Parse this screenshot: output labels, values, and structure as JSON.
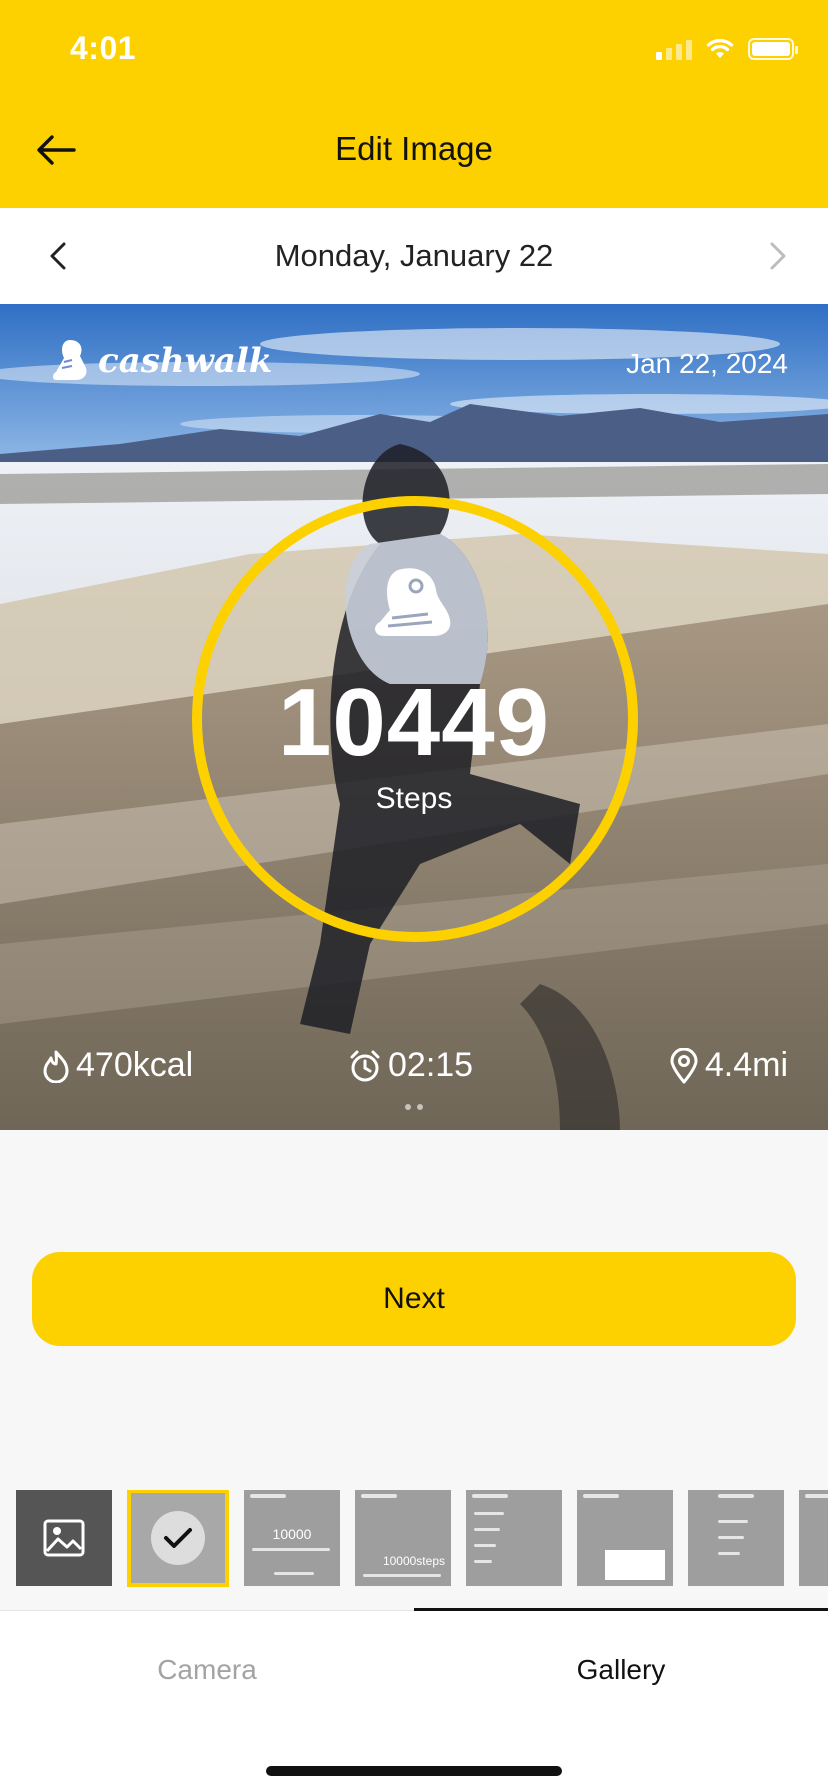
{
  "status_bar": {
    "time": "4:01",
    "icons": [
      "signal-icon",
      "wifi-icon",
      "battery-icon"
    ]
  },
  "header": {
    "title": "Edit Image",
    "back_icon": "arrow-left-icon"
  },
  "date_nav": {
    "label": "Monday, January 22",
    "prev_icon": "chevron-left-icon",
    "next_icon": "chevron-right-icon"
  },
  "photo": {
    "brand": "cashwalk",
    "date": "Jan 22, 2024",
    "steps": "10449",
    "steps_label": "Steps",
    "stats": {
      "kcal": "470kcal",
      "time": "02:15",
      "distance": "4.4mi"
    },
    "ring_color": "#fdd000"
  },
  "actions": {
    "next_label": "Next"
  },
  "thumbnails": {
    "gallery_icon": "image-icon",
    "selected_index": 1,
    "items": [
      {
        "preview": ""
      },
      {
        "preview": "10000"
      },
      {
        "preview": "10000steps"
      },
      {
        "preview": ""
      },
      {
        "preview": ""
      },
      {
        "preview": ""
      },
      {
        "preview": ""
      }
    ]
  },
  "tabs": {
    "camera": "Camera",
    "gallery": "Gallery",
    "active": "Gallery"
  },
  "colors": {
    "accent": "#fdd000",
    "background": "#f7f7f7",
    "text_primary": "#111111",
    "text_inactive": "#a3a3a3"
  }
}
